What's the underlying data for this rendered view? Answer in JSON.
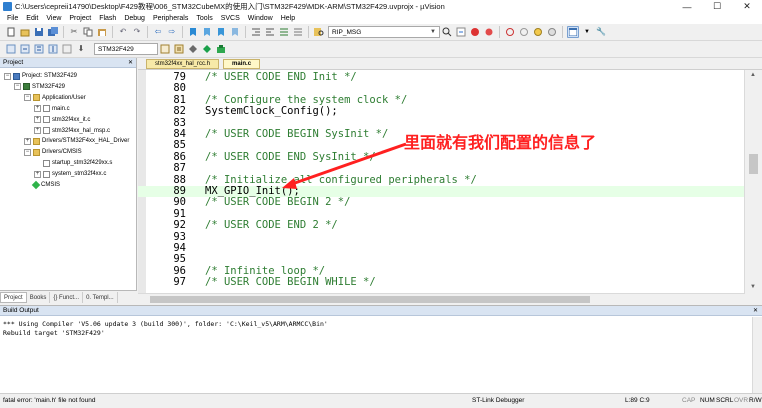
{
  "window": {
    "title": "C:\\Users\\cepreii14790\\Desktop\\F429教程\\006_STM32CubeMX的使用入门\\STM32F429\\MDK-ARM\\STM32F429.uvprojx - µVision",
    "min": "—",
    "max": "☐",
    "close": "✕"
  },
  "menu": [
    "File",
    "Edit",
    "View",
    "Project",
    "Flash",
    "Debug",
    "Peripherals",
    "Tools",
    "SVCS",
    "Window",
    "Help"
  ],
  "toolbar1": {
    "find_combo": "RIP_MSG"
  },
  "toolbar2": {
    "target_combo": "STM32F429"
  },
  "project": {
    "header": "Project",
    "pin": "✕",
    "root": "Project: STM32F429",
    "target": "STM32F429",
    "items": [
      {
        "label": "Application/User",
        "kind": "folder",
        "depth": 2,
        "exp": "−"
      },
      {
        "label": "main.c",
        "kind": "file",
        "depth": 3,
        "exp": "+"
      },
      {
        "label": "stm32f4xx_it.c",
        "kind": "file",
        "depth": 3,
        "exp": "+"
      },
      {
        "label": "stm32f4xx_hal_msp.c",
        "kind": "file",
        "depth": 3,
        "exp": "+"
      },
      {
        "label": "Drivers/STM32F4xx_HAL_Driver",
        "kind": "folder",
        "depth": 2,
        "exp": "+"
      },
      {
        "label": "Drivers/CMSIS",
        "kind": "folder",
        "depth": 2,
        "exp": "−"
      },
      {
        "label": "startup_stm32f429xx.s",
        "kind": "file",
        "depth": 3,
        "exp": ""
      },
      {
        "label": "system_stm32f4xx.c",
        "kind": "file",
        "depth": 3,
        "exp": "+"
      },
      {
        "label": "CMSIS",
        "kind": "gem",
        "depth": 2,
        "exp": ""
      }
    ],
    "tabs": [
      "Project",
      "Books",
      "{} Funct...",
      "0. Templ..."
    ]
  },
  "editor": {
    "tabs": [
      "stm32f4xx_hal_rcc.h",
      "main.c"
    ],
    "active_tab": 1,
    "lines": [
      {
        "n": "79",
        "code": "/* USER CODE END Init */",
        "comment": true
      },
      {
        "n": "80",
        "code": "",
        "comment": false
      },
      {
        "n": "81",
        "code": "/* Configure the system clock */",
        "comment": true
      },
      {
        "n": "82",
        "code": "SystemClock_Config();",
        "comment": false
      },
      {
        "n": "83",
        "code": "",
        "comment": false
      },
      {
        "n": "84",
        "code": "/* USER CODE BEGIN SysInit */",
        "comment": true
      },
      {
        "n": "85",
        "code": "",
        "comment": false
      },
      {
        "n": "86",
        "code": "/* USER CODE END SysInit */",
        "comment": true
      },
      {
        "n": "87",
        "code": "",
        "comment": false
      },
      {
        "n": "88",
        "code": "/* Initialize all configured peripherals */",
        "comment": true
      },
      {
        "n": "89",
        "code": "MX_GPIO_Init();",
        "comment": false
      },
      {
        "n": "90",
        "code": "/* USER CODE BEGIN 2 */",
        "comment": true
      },
      {
        "n": "91",
        "code": "",
        "comment": false
      },
      {
        "n": "92",
        "code": "/* USER CODE END 2 */",
        "comment": true
      },
      {
        "n": "93",
        "code": "",
        "comment": false
      },
      {
        "n": "94",
        "code": "",
        "comment": false
      },
      {
        "n": "95",
        "code": "",
        "comment": false
      },
      {
        "n": "96",
        "code": "/* Infinite loop */",
        "comment": true
      },
      {
        "n": "97",
        "code": "/* USER CODE BEGIN WHILE */",
        "comment": true
      }
    ],
    "current_line": "89",
    "annotation": "里面就有我们配置的信息了",
    "annotation_color": "#ff2020"
  },
  "build": {
    "header": "Build Output",
    "pin": "✕",
    "lines": [
      "*** Using Compiler 'V5.06 update 3 (build 300)', folder: 'C:\\Keil_v5\\ARM\\ARMCC\\Bin'",
      "Rebuild target 'STM32F429'"
    ]
  },
  "status": {
    "message": "fatal error: 'main.h' file not found",
    "debugger": "ST-Link Debugger",
    "position": "L:89 C:9",
    "cap": "CAP",
    "num": "NUM",
    "scrl": "SCRL",
    "ovr": "OVR",
    "rw": "R/W"
  }
}
